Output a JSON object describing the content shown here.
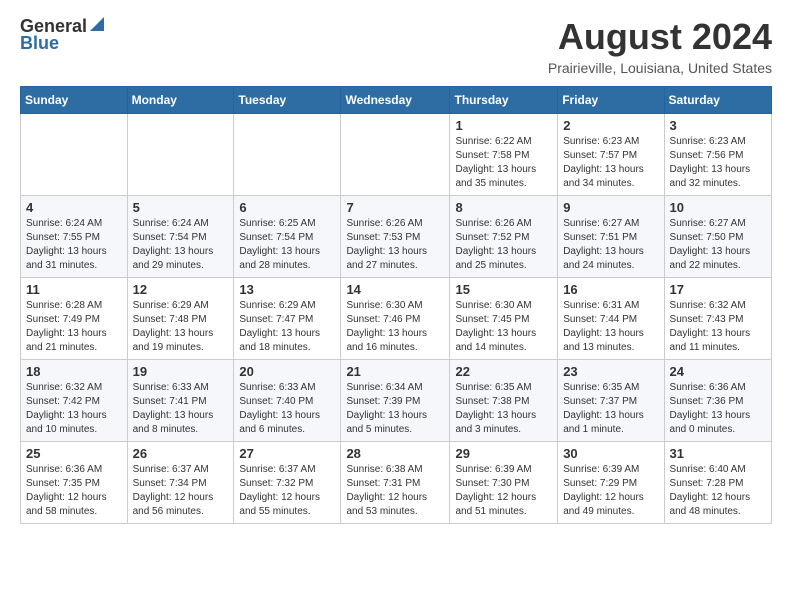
{
  "header": {
    "logo_general": "General",
    "logo_blue": "Blue",
    "month_year": "August 2024",
    "location": "Prairieville, Louisiana, United States"
  },
  "calendar": {
    "days_of_week": [
      "Sunday",
      "Monday",
      "Tuesday",
      "Wednesday",
      "Thursday",
      "Friday",
      "Saturday"
    ],
    "weeks": [
      [
        {
          "day": "",
          "info": ""
        },
        {
          "day": "",
          "info": ""
        },
        {
          "day": "",
          "info": ""
        },
        {
          "day": "",
          "info": ""
        },
        {
          "day": "1",
          "info": "Sunrise: 6:22 AM\nSunset: 7:58 PM\nDaylight: 13 hours\nand 35 minutes."
        },
        {
          "day": "2",
          "info": "Sunrise: 6:23 AM\nSunset: 7:57 PM\nDaylight: 13 hours\nand 34 minutes."
        },
        {
          "day": "3",
          "info": "Sunrise: 6:23 AM\nSunset: 7:56 PM\nDaylight: 13 hours\nand 32 minutes."
        }
      ],
      [
        {
          "day": "4",
          "info": "Sunrise: 6:24 AM\nSunset: 7:55 PM\nDaylight: 13 hours\nand 31 minutes."
        },
        {
          "day": "5",
          "info": "Sunrise: 6:24 AM\nSunset: 7:54 PM\nDaylight: 13 hours\nand 29 minutes."
        },
        {
          "day": "6",
          "info": "Sunrise: 6:25 AM\nSunset: 7:54 PM\nDaylight: 13 hours\nand 28 minutes."
        },
        {
          "day": "7",
          "info": "Sunrise: 6:26 AM\nSunset: 7:53 PM\nDaylight: 13 hours\nand 27 minutes."
        },
        {
          "day": "8",
          "info": "Sunrise: 6:26 AM\nSunset: 7:52 PM\nDaylight: 13 hours\nand 25 minutes."
        },
        {
          "day": "9",
          "info": "Sunrise: 6:27 AM\nSunset: 7:51 PM\nDaylight: 13 hours\nand 24 minutes."
        },
        {
          "day": "10",
          "info": "Sunrise: 6:27 AM\nSunset: 7:50 PM\nDaylight: 13 hours\nand 22 minutes."
        }
      ],
      [
        {
          "day": "11",
          "info": "Sunrise: 6:28 AM\nSunset: 7:49 PM\nDaylight: 13 hours\nand 21 minutes."
        },
        {
          "day": "12",
          "info": "Sunrise: 6:29 AM\nSunset: 7:48 PM\nDaylight: 13 hours\nand 19 minutes."
        },
        {
          "day": "13",
          "info": "Sunrise: 6:29 AM\nSunset: 7:47 PM\nDaylight: 13 hours\nand 18 minutes."
        },
        {
          "day": "14",
          "info": "Sunrise: 6:30 AM\nSunset: 7:46 PM\nDaylight: 13 hours\nand 16 minutes."
        },
        {
          "day": "15",
          "info": "Sunrise: 6:30 AM\nSunset: 7:45 PM\nDaylight: 13 hours\nand 14 minutes."
        },
        {
          "day": "16",
          "info": "Sunrise: 6:31 AM\nSunset: 7:44 PM\nDaylight: 13 hours\nand 13 minutes."
        },
        {
          "day": "17",
          "info": "Sunrise: 6:32 AM\nSunset: 7:43 PM\nDaylight: 13 hours\nand 11 minutes."
        }
      ],
      [
        {
          "day": "18",
          "info": "Sunrise: 6:32 AM\nSunset: 7:42 PM\nDaylight: 13 hours\nand 10 minutes."
        },
        {
          "day": "19",
          "info": "Sunrise: 6:33 AM\nSunset: 7:41 PM\nDaylight: 13 hours\nand 8 minutes."
        },
        {
          "day": "20",
          "info": "Sunrise: 6:33 AM\nSunset: 7:40 PM\nDaylight: 13 hours\nand 6 minutes."
        },
        {
          "day": "21",
          "info": "Sunrise: 6:34 AM\nSunset: 7:39 PM\nDaylight: 13 hours\nand 5 minutes."
        },
        {
          "day": "22",
          "info": "Sunrise: 6:35 AM\nSunset: 7:38 PM\nDaylight: 13 hours\nand 3 minutes."
        },
        {
          "day": "23",
          "info": "Sunrise: 6:35 AM\nSunset: 7:37 PM\nDaylight: 13 hours\nand 1 minute."
        },
        {
          "day": "24",
          "info": "Sunrise: 6:36 AM\nSunset: 7:36 PM\nDaylight: 13 hours\nand 0 minutes."
        }
      ],
      [
        {
          "day": "25",
          "info": "Sunrise: 6:36 AM\nSunset: 7:35 PM\nDaylight: 12 hours\nand 58 minutes."
        },
        {
          "day": "26",
          "info": "Sunrise: 6:37 AM\nSunset: 7:34 PM\nDaylight: 12 hours\nand 56 minutes."
        },
        {
          "day": "27",
          "info": "Sunrise: 6:37 AM\nSunset: 7:32 PM\nDaylight: 12 hours\nand 55 minutes."
        },
        {
          "day": "28",
          "info": "Sunrise: 6:38 AM\nSunset: 7:31 PM\nDaylight: 12 hours\nand 53 minutes."
        },
        {
          "day": "29",
          "info": "Sunrise: 6:39 AM\nSunset: 7:30 PM\nDaylight: 12 hours\nand 51 minutes."
        },
        {
          "day": "30",
          "info": "Sunrise: 6:39 AM\nSunset: 7:29 PM\nDaylight: 12 hours\nand 49 minutes."
        },
        {
          "day": "31",
          "info": "Sunrise: 6:40 AM\nSunset: 7:28 PM\nDaylight: 12 hours\nand 48 minutes."
        }
      ]
    ]
  }
}
